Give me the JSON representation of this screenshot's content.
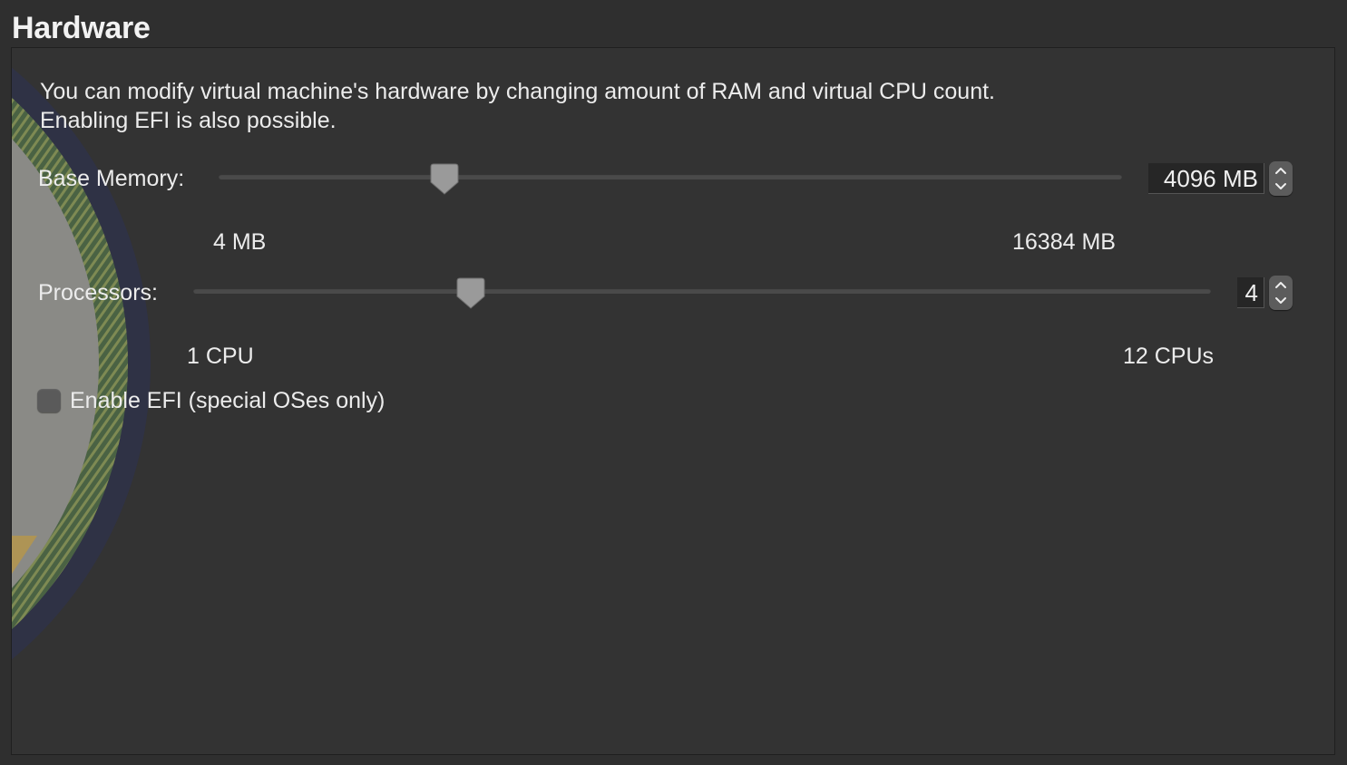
{
  "section": {
    "title": "Hardware"
  },
  "description": {
    "line1": "You can modify virtual machine's hardware by changing amount of RAM and virtual CPU count.",
    "line2": "Enabling EFI is also possible."
  },
  "memory": {
    "label": "Base Memory:",
    "value": "4096 MB",
    "min_label": "4 MB",
    "max_label": "16384 MB",
    "slider_fraction": 0.25
  },
  "processors": {
    "label": "Processors:",
    "value": "4",
    "min_label": "1 CPU",
    "max_label": "12 CPUs",
    "slider_fraction": 0.2727
  },
  "efi": {
    "label": "Enable EFI (special OSes only)",
    "checked": false
  },
  "colors": {
    "background": "#2f2f2f",
    "panel": "#333333",
    "text": "#ececec",
    "control": "#5c5c5c"
  },
  "icons": {
    "stepper_up": "chevron-up-icon",
    "stepper_down": "chevron-down-icon"
  }
}
